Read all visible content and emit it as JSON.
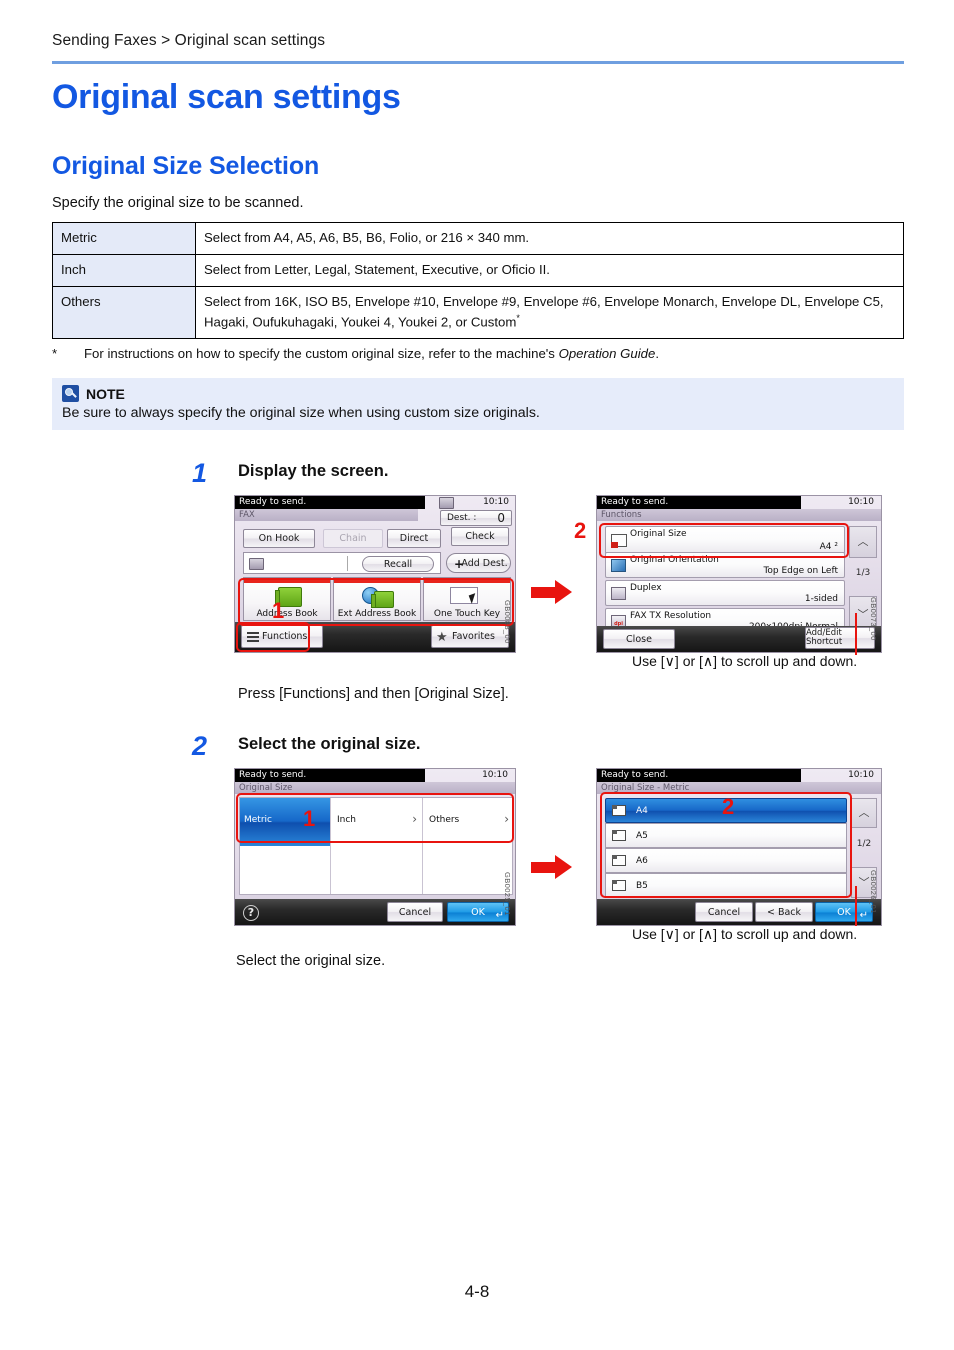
{
  "breadcrumb": "Sending Faxes > Original scan settings",
  "page_title": "Original scan settings",
  "section_title": "Original Size Selection",
  "intro": "Specify the original size to be scanned.",
  "table": {
    "rows": [
      {
        "key": "Metric",
        "value": "Select from A4, A5, A6, B5, B6, Folio, or 216 × 340 mm."
      },
      {
        "key": "Inch",
        "value": "Select from Letter, Legal, Statement, Executive, or Oficio II."
      },
      {
        "key": "Others",
        "value": "Select from 16K, ISO B5, Envelope #10, Envelope #9, Envelope #6, Envelope Monarch, Envelope DL, Envelope C5, Hagaki, Oufukuhagaki, Youkei 4, Youkei 2, or Custom",
        "value_suffix_star": "*"
      }
    ]
  },
  "footnote": {
    "mark": "*",
    "text_before": "For instructions on how to specify the custom original size, refer to the machine's ",
    "italic": "Operation Guide",
    "text_after": "."
  },
  "note": {
    "title": "NOTE",
    "text": "Be sure to always specify the original size when using custom size originals."
  },
  "steps": [
    {
      "number": "1",
      "title": "Display the screen.",
      "body": "Press [Functions] and then [Original Size].",
      "caption_right": "Use [∨] or [∧] to scroll up and down."
    },
    {
      "number": "2",
      "title": "Select the original size.",
      "body": "Select the original size.",
      "caption_right": "Use [∨] or [∧] to scroll up and down."
    }
  ],
  "screens": {
    "fax_home": {
      "status": "Ready to send.",
      "time": "10:10",
      "tab": "FAX",
      "dest_label": "Dest. :",
      "dest_count": "0",
      "check_button": "Check",
      "on_hook": "On Hook",
      "chain": "Chain",
      "direct": "Direct",
      "recall": "Recall",
      "add_dest": "Add Dest.",
      "tiles": [
        "Address Book",
        "Ext Address Book",
        "One Touch Key"
      ],
      "functions": "Functions",
      "favorites": "Favorites",
      "id": "GB0088_00",
      "callout": "1"
    },
    "functions": {
      "status": "Ready to send.",
      "time": "10:10",
      "tab": "Functions",
      "rows": [
        {
          "label": "Original Size",
          "value": "A4 ²"
        },
        {
          "label": "Original Orientation",
          "value": "Top Edge on Left"
        },
        {
          "label": "Duplex",
          "value": "1-sided"
        },
        {
          "label": "FAX TX Resolution",
          "value": "200x100dpi Normal"
        }
      ],
      "page_indicator": "1/3",
      "close": "Close",
      "add_edit_shortcut": "Add/Edit Shortcut",
      "id": "GB0073_00",
      "callout": "2"
    },
    "original_size": {
      "status": "Ready to send.",
      "time": "10:10",
      "tab": "Original Size",
      "options": [
        "Metric",
        "Inch",
        "Others"
      ],
      "cancel": "Cancel",
      "ok": "OK",
      "id": "GB0025_01",
      "callout": "1"
    },
    "original_size_metric": {
      "status": "Ready to send.",
      "time": "10:10",
      "tab": "Original Size - Metric",
      "items": [
        "A4",
        "A5",
        "A6",
        "B5"
      ],
      "page_indicator": "1/2",
      "cancel": "Cancel",
      "back": "< Back",
      "ok": "OK",
      "id": "GB0026_01",
      "callout": "2"
    }
  },
  "page_number": "4-8"
}
